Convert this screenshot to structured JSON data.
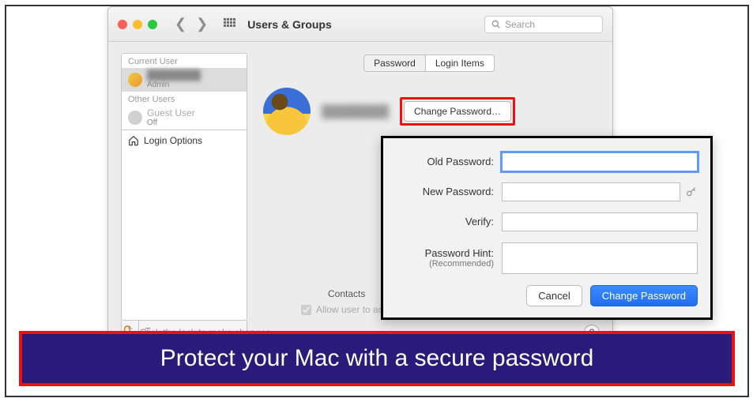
{
  "window": {
    "title": "Users & Groups",
    "search_placeholder": "Search"
  },
  "sidebar": {
    "current_label": "Current User",
    "current_user_role": "Admin",
    "other_label": "Other Users",
    "guest_name": "Guest User",
    "guest_status": "Off",
    "login_options": "Login Options"
  },
  "tabs": {
    "password": "Password",
    "login_items": "Login Items"
  },
  "main": {
    "change_password_btn": "Change Password…",
    "contacts_label": "Contacts",
    "admin_checkbox": "Allow user to administer"
  },
  "footer": {
    "lock_text": "Click the lock to make changes.",
    "help": "?"
  },
  "dialog": {
    "old_label": "Old Password:",
    "new_label": "New Password:",
    "verify_label": "Verify:",
    "hint_label": "Password Hint:",
    "hint_sub": "(Recommended)",
    "cancel": "Cancel",
    "submit": "Change Password"
  },
  "banner": "Protect your Mac with a secure password"
}
